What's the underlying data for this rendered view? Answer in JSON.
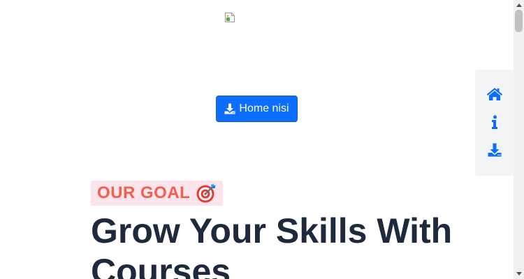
{
  "header": {
    "logo_icon": "broken-image-icon"
  },
  "download_button": {
    "label": "Home nisi",
    "icon": "download-icon",
    "color": "#0d6efd"
  },
  "goal_section": {
    "badge_text": "OUR GOAL",
    "badge_icon": "target-icon",
    "badge_color": "#f0604f",
    "badge_bg": "#fce4ec",
    "headline": "Grow Your Skills With Courses"
  },
  "side_nav": {
    "items": [
      {
        "icon": "home-icon"
      },
      {
        "icon": "info-icon"
      },
      {
        "icon": "download-icon"
      }
    ],
    "accent": "#0d6efd"
  }
}
